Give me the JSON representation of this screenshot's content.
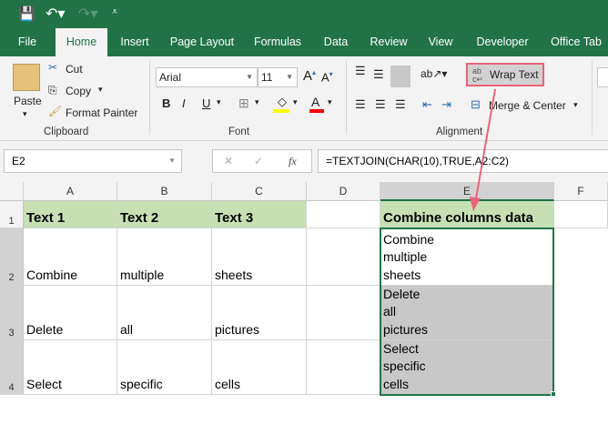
{
  "qat": {
    "save_icon": "save-icon",
    "undo_icon": "undo-icon",
    "redo_icon": "redo-icon",
    "customize_icon": "customize-icon"
  },
  "tabs": [
    "File",
    "Home",
    "Insert",
    "Page Layout",
    "Formulas",
    "Data",
    "Review",
    "View",
    "Developer",
    "Office Tab"
  ],
  "ribbon": {
    "clipboard": {
      "paste": "Paste",
      "cut": "Cut",
      "copy": "Copy",
      "format_painter": "Format Painter",
      "label": "Clipboard"
    },
    "font": {
      "name": "Arial",
      "size": "11",
      "bold": "B",
      "italic": "I",
      "underline": "U",
      "label": "Font",
      "highlight_color": "#ffff00",
      "font_color": "#ff0000"
    },
    "alignment": {
      "wrap_text": "Wrap Text",
      "merge_center": "Merge & Center",
      "label": "Alignment"
    }
  },
  "formula_bar": {
    "name_box": "E2",
    "fx": "fx",
    "formula": "=TEXTJOIN(CHAR(10),TRUE,A2:C2)"
  },
  "sheet": {
    "columns": [
      "A",
      "B",
      "C",
      "D",
      "E",
      "F"
    ],
    "rows": [
      "1",
      "2",
      "3",
      "4"
    ],
    "cells": {
      "A1": "Text 1",
      "B1": "Text 2",
      "C1": "Text 3",
      "E1": "Combine columns data",
      "A2": "Combine",
      "B2": "multiple",
      "C2": "sheets",
      "E2": "Combine\nmultiple\nsheets",
      "A3": "Delete",
      "B3": "all",
      "C3": "pictures",
      "E3": "Delete\nall\npictures",
      "A4": "Select",
      "B4": "specific",
      "C4": "cells",
      "E4": "Select\nspecific\ncells"
    }
  },
  "colors": {
    "brand": "#217346",
    "header_fill": "#c6e0b4",
    "highlight": "#e8637a"
  }
}
